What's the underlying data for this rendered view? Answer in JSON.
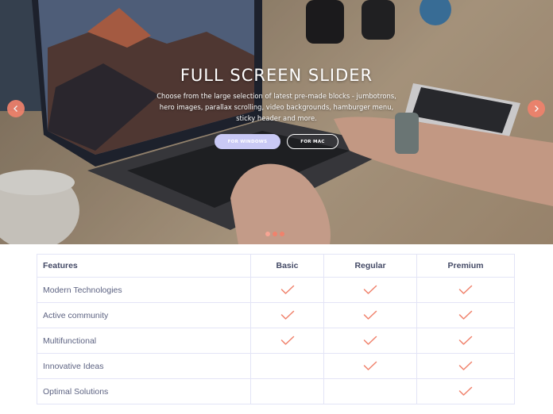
{
  "slider": {
    "title": "FULL SCREEN SLIDER",
    "description": "Choose from the large selection of latest pre-made blocks - jumbotrons, hero images, parallax scrolling, video backgrounds, hamburger menu, sticky header and more.",
    "button_windows": "FOR WINDOWS",
    "button_mac": "FOR MAC",
    "prev_icon": "chevron-left-icon",
    "next_icon": "chevron-right-icon",
    "indicator_count": 3,
    "active_indicator": 1,
    "accent_color": "#f0826c"
  },
  "table": {
    "headers": [
      "Features",
      "Basic",
      "Regular",
      "Premium"
    ],
    "rows": [
      {
        "feature": "Modern Technologies",
        "basic": true,
        "regular": true,
        "premium": true
      },
      {
        "feature": "Active community",
        "basic": true,
        "regular": true,
        "premium": true
      },
      {
        "feature": "Multifunctional",
        "basic": true,
        "regular": true,
        "premium": true
      },
      {
        "feature": "Innovative Ideas",
        "basic": false,
        "regular": true,
        "premium": true
      },
      {
        "feature": "Optimal Solutions",
        "basic": false,
        "regular": false,
        "premium": true
      }
    ],
    "check_icon": "check-icon",
    "check_color": "#f0826c"
  }
}
